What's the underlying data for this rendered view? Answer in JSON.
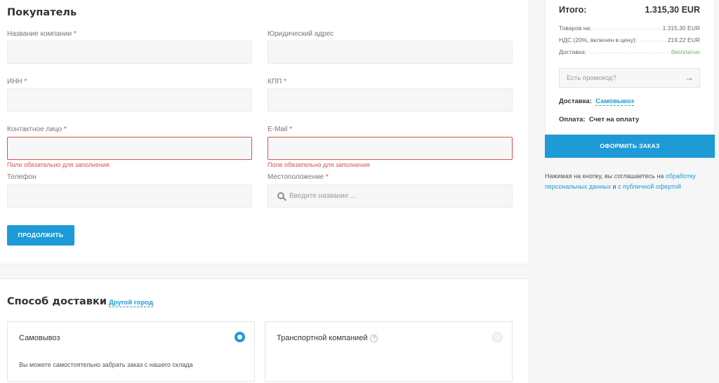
{
  "buyer": {
    "title": "Покупатель",
    "fields": {
      "company": {
        "label": "Название компании",
        "required": true,
        "value": ""
      },
      "legal_address": {
        "label": "Юридический адрес",
        "required": false,
        "value": ""
      },
      "inn": {
        "label": "ИНН",
        "required": true,
        "value": ""
      },
      "kpp": {
        "label": "КПП",
        "required": true,
        "value": ""
      },
      "contact": {
        "label": "Контактное лицо",
        "required": true,
        "value": "",
        "error": "Поле обязательно для заполнения"
      },
      "email": {
        "label": "E-Mail",
        "required": true,
        "value": "",
        "error": "Поле обязательно для заполнения"
      },
      "phone": {
        "label": "Телефон",
        "required": false,
        "value": ""
      },
      "location": {
        "label": "Местоположение",
        "required": true,
        "placeholder": "Введите название ..."
      }
    },
    "required_mark": "*",
    "continue_label": "ПРОДОЛЖИТЬ"
  },
  "delivery": {
    "title": "Способ доставки",
    "other_city": "Другой город",
    "options": [
      {
        "title": "Самовывоз",
        "description": "Вы можете самостоятельно забрать заказ с нашего склада",
        "selected": true
      },
      {
        "title": "Транспортной компанией",
        "help": "?",
        "selected": false
      }
    ]
  },
  "summary": {
    "total_label": "Итого:",
    "total_value": "1.315,30 EUR",
    "rows": [
      {
        "label": "Товаров на:",
        "value": "1.315,30 EUR"
      },
      {
        "label": "НДС (20%, включен в цену):",
        "value": "219,22 EUR"
      },
      {
        "label": "Доставка:",
        "value": "бесплатно"
      }
    ],
    "promo_placeholder": "Есть промокод?",
    "delivery_label": "Доставка:",
    "delivery_value": "Самовывоз",
    "payment_label": "Оплата:",
    "payment_value": "Счет на оплату",
    "order_button": "ОФОРМИТЬ ЗАКАЗ",
    "agree_text": "Нажимая на кнопку, вы соглашаетесь на",
    "agree_link1": "обработку персональных данных",
    "agree_and": "и",
    "agree_link2": "с публичной офертой"
  },
  "colors": {
    "accent": "#1e9ad6",
    "error": "#d9534f",
    "free": "#5cb85c"
  }
}
